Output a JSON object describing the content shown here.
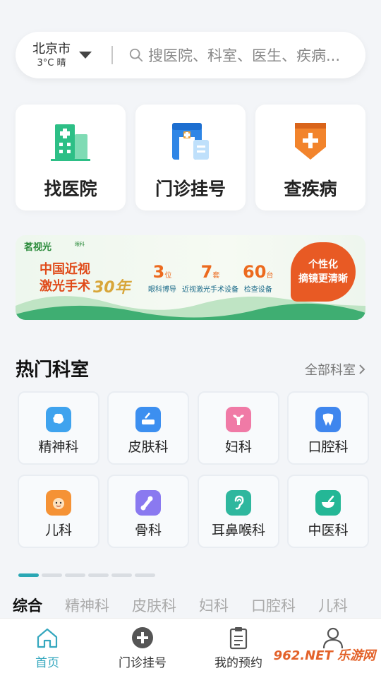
{
  "location": {
    "city": "北京市",
    "weather": "3°C 晴"
  },
  "search": {
    "placeholder": "搜医院、科室、医生、疾病..."
  },
  "quick_actions": [
    {
      "label": "找医院",
      "icon": "hospital-building-icon"
    },
    {
      "label": "门诊挂号",
      "icon": "clinic-registration-icon"
    },
    {
      "label": "查疾病",
      "icon": "disease-shield-icon"
    }
  ],
  "banner": {
    "brand": "茗视光",
    "brand_sub": "眼科",
    "slogan_line1": "中国近视",
    "slogan_line2": "激光手术",
    "years": "30年",
    "stats": [
      {
        "num": "3",
        "unit": "位",
        "label": "眼科博导"
      },
      {
        "num": "7",
        "unit": "套",
        "label": "近视激光手术设备"
      },
      {
        "num": "60",
        "unit": "台",
        "label": "检查设备"
      }
    ],
    "bubble_line1": "个性化",
    "bubble_line2": "摘镜更清晰"
  },
  "departments_section": {
    "title": "热门科室",
    "more": "全部科室"
  },
  "departments": [
    {
      "label": "精神科",
      "icon": "brain-icon",
      "color": "#3fa3ee"
    },
    {
      "label": "皮肤科",
      "icon": "skin-icon",
      "color": "#3c8ff0"
    },
    {
      "label": "妇科",
      "icon": "uterus-icon",
      "color": "#f07aa6"
    },
    {
      "label": "口腔科",
      "icon": "tooth-icon",
      "color": "#3f86ee"
    },
    {
      "label": "儿科",
      "icon": "baby-icon",
      "color": "#f59235"
    },
    {
      "label": "骨科",
      "icon": "bone-icon",
      "color": "#8a79f0"
    },
    {
      "label": "耳鼻喉科",
      "icon": "ear-icon",
      "color": "#2fb79e"
    },
    {
      "label": "中医科",
      "icon": "mortar-icon",
      "color": "#24b796"
    }
  ],
  "category_tabs": [
    "综合",
    "精神科",
    "皮肤科",
    "妇科",
    "口腔科",
    "儿科"
  ],
  "bottom_nav": [
    {
      "label": "首页",
      "icon": "home-icon",
      "active": true
    },
    {
      "label": "门诊挂号",
      "icon": "add-circle-icon"
    },
    {
      "label": "我的预约",
      "icon": "clipboard-icon"
    },
    {
      "label": "",
      "icon": "user-icon"
    }
  ],
  "watermark": "962.NET 乐游网",
  "colors": {
    "accent": "#34a7be",
    "card_green": "#2dbf86",
    "card_blue": "#2f86e6",
    "card_orange": "#f2842c"
  }
}
